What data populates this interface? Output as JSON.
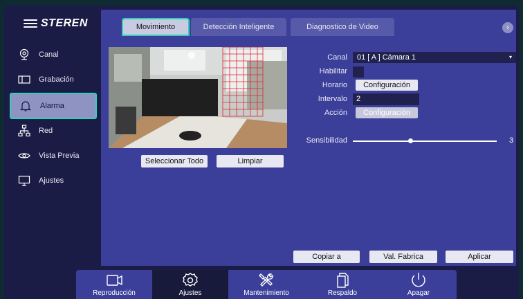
{
  "brand": {
    "logo_text": "STEREN"
  },
  "sidebar": {
    "items": [
      {
        "label": "Canal",
        "icon": "camera-icon"
      },
      {
        "label": "Grabación",
        "icon": "recording-icon"
      },
      {
        "label": "Alarma",
        "icon": "bell-icon",
        "active": true
      },
      {
        "label": "Red",
        "icon": "network-icon"
      },
      {
        "label": "Vista Previa",
        "icon": "eye-icon"
      },
      {
        "label": "Ajustes",
        "icon": "monitor-icon"
      }
    ]
  },
  "tabs": [
    {
      "label": "Movimiento",
      "active": true
    },
    {
      "label": "Detección Inteligente"
    },
    {
      "label": "Diagnostico de Video"
    }
  ],
  "tab_next": "›",
  "video_actions": {
    "select_all": "Seleccionar Todo",
    "clear": "Limpiar"
  },
  "form": {
    "canal_label": "Canal",
    "canal_value": "01 [ A ] Cámara 1",
    "habilitar_label": "Habilitar",
    "habilitar_checked": false,
    "horario_label": "Horario",
    "horario_button": "Configuración",
    "intervalo_label": "Intervalo",
    "intervalo_value": "2",
    "accion_label": "Acción",
    "accion_button": "Configuración",
    "sensibilidad_label": "Sensibilidad",
    "sensibilidad_value": "3",
    "sensibilidad_min": 1,
    "sensibilidad_max": 6
  },
  "footer_buttons": {
    "copy": "Copiar a",
    "defaults": "Val. Fabrica",
    "apply": "Aplicar"
  },
  "dock": [
    {
      "label": "Reproducción",
      "icon": "video-camera-icon"
    },
    {
      "label": "Ajustes",
      "icon": "settings-gear-icon",
      "active": true
    },
    {
      "label": "Mantenimiento",
      "icon": "tools-icon"
    },
    {
      "label": "Respaldo",
      "icon": "copy-files-icon"
    },
    {
      "label": "Apagar",
      "icon": "power-icon"
    }
  ],
  "colors": {
    "accent": "#2fd1b9",
    "panel": "#3c3f9a",
    "sidebar": "#1b1c46",
    "motion_grid": "#e2262f"
  }
}
